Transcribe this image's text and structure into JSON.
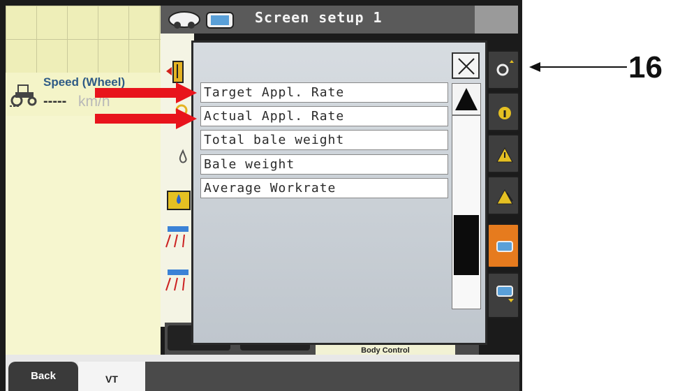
{
  "header": {
    "title": "Screen setup 1"
  },
  "left_panel": {
    "speed_label": "Speed (Wheel)",
    "speed_value": "-----",
    "speed_unit": "km/h"
  },
  "popup": {
    "items": [
      {
        "label": "Target Appl. Rate"
      },
      {
        "label": "Actual Appl. Rate"
      },
      {
        "label": "Total bale weight"
      },
      {
        "label": "Bale weight"
      },
      {
        "label": "Average Workrate"
      }
    ],
    "scroll_position": 0.75
  },
  "bottom_bar": {
    "back_label": "Back",
    "vt_label": "VT",
    "body_control_label": "Body Control"
  },
  "annotation": {
    "callout_number": "16"
  },
  "colors": {
    "header_bg": "#5a5a5a",
    "highlight_arrow": "#e8141c",
    "active_softkey": "#e67b1e",
    "speed_label": "#2f5b86"
  },
  "icons": {
    "softkeys": [
      "wrench-settings-icon",
      "info-icon",
      "warning-icon",
      "warning-filter-icon",
      "screen-l1-icon",
      "screen-l2-icon"
    ]
  }
}
